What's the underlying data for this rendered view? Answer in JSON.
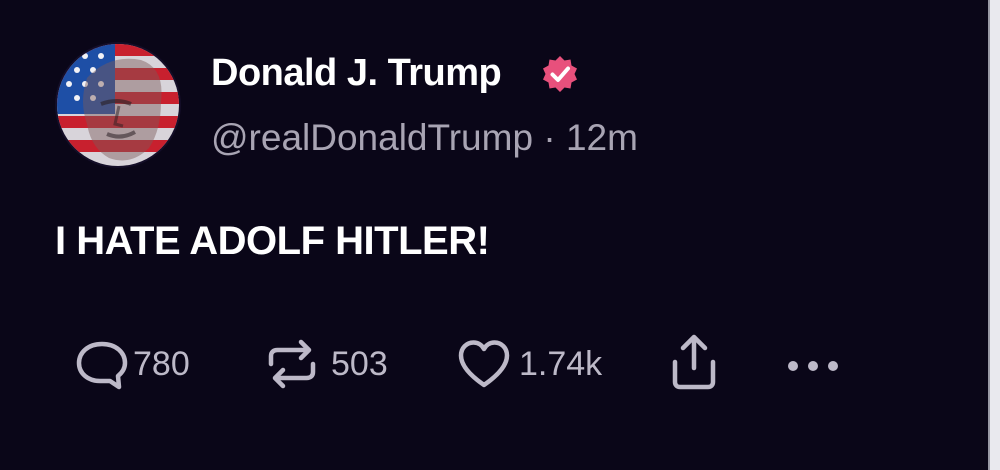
{
  "post": {
    "author": {
      "display_name": "Donald J. Trump",
      "handle": "@realDonaldTrump",
      "separator": "·",
      "timestamp": "12m",
      "verified": true
    },
    "text": "I HATE ADOLF HITLER!",
    "actions": {
      "replies": {
        "icon": "speech-bubble-icon",
        "count": "780"
      },
      "reposts": {
        "icon": "repost-arrows-icon",
        "count": "503"
      },
      "likes": {
        "icon": "heart-icon",
        "count": "1.74k"
      },
      "share": {
        "icon": "share-upload-icon"
      },
      "more": {
        "icon": "more-dots-icon"
      }
    }
  },
  "colors": {
    "background": "#0a0618",
    "text_primary": "#ffffff",
    "text_secondary": "#a8a4b3",
    "icon": "#bdb9c8",
    "verified_badge": "#e8507c"
  }
}
